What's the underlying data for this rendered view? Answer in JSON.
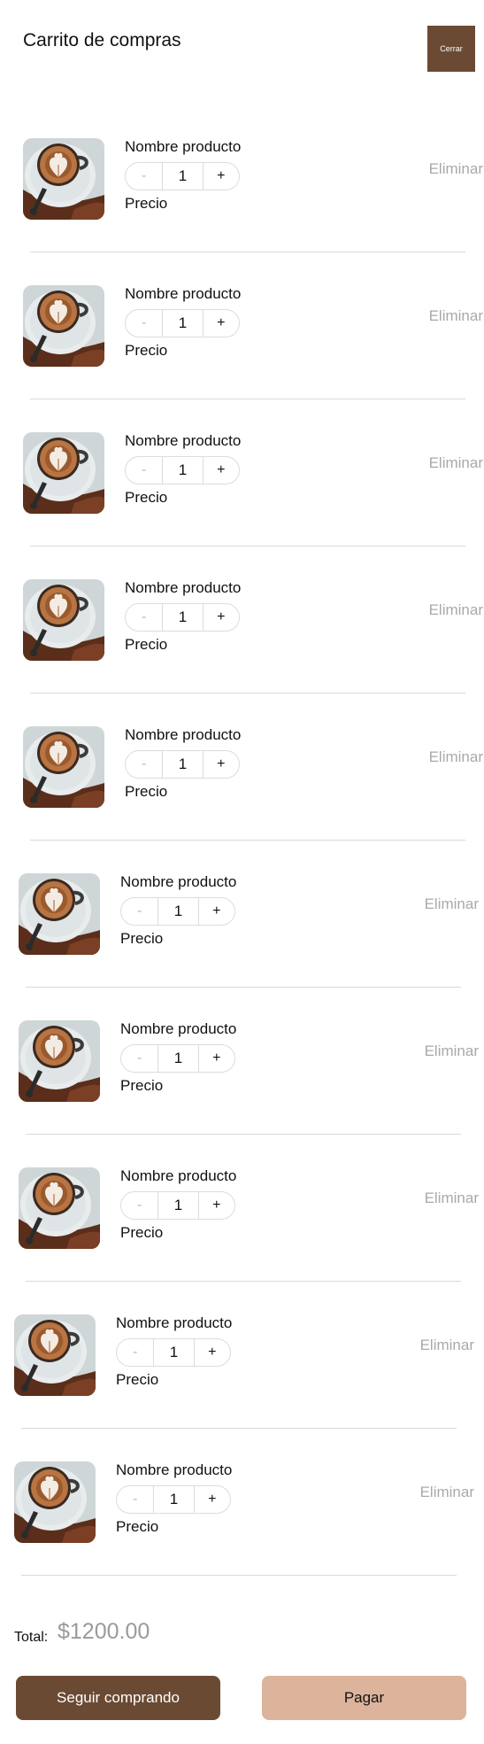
{
  "header": {
    "title": "Carrito de compras",
    "close_label": "Cerrar"
  },
  "items": [
    {
      "name": "Nombre producto",
      "quantity": "1",
      "minus": "-",
      "plus": "+",
      "price": "Precio",
      "remove": "Eliminar"
    },
    {
      "name": "Nombre producto",
      "quantity": "1",
      "minus": "-",
      "plus": "+",
      "price": "Precio",
      "remove": "Eliminar"
    },
    {
      "name": "Nombre producto",
      "quantity": "1",
      "minus": "-",
      "plus": "+",
      "price": "Precio",
      "remove": "Eliminar"
    },
    {
      "name": "Nombre producto",
      "quantity": "1",
      "minus": "-",
      "plus": "+",
      "price": "Precio",
      "remove": "Eliminar"
    },
    {
      "name": "Nombre producto",
      "quantity": "1",
      "minus": "-",
      "plus": "+",
      "price": "Precio",
      "remove": "Eliminar"
    },
    {
      "name": "Nombre producto",
      "quantity": "1",
      "minus": "-",
      "plus": "+",
      "price": "Precio",
      "remove": "Eliminar"
    },
    {
      "name": "Nombre producto",
      "quantity": "1",
      "minus": "-",
      "plus": "+",
      "price": "Precio",
      "remove": "Eliminar"
    },
    {
      "name": "Nombre producto",
      "quantity": "1",
      "minus": "-",
      "plus": "+",
      "price": "Precio",
      "remove": "Eliminar"
    },
    {
      "name": "Nombre producto",
      "quantity": "1",
      "minus": "-",
      "plus": "+",
      "price": "Precio",
      "remove": "Eliminar"
    },
    {
      "name": "Nombre producto",
      "quantity": "1",
      "minus": "-",
      "plus": "+",
      "price": "Precio",
      "remove": "Eliminar"
    }
  ],
  "summary": {
    "total_label": "Total:",
    "total_value": "$1200.00"
  },
  "actions": {
    "continue_label": "Seguir comprando",
    "pay_label": "Pagar"
  },
  "colors": {
    "brand_brown": "#6b4a33",
    "accent_beige": "#dcb39b",
    "muted_text": "#a9a9a9"
  }
}
